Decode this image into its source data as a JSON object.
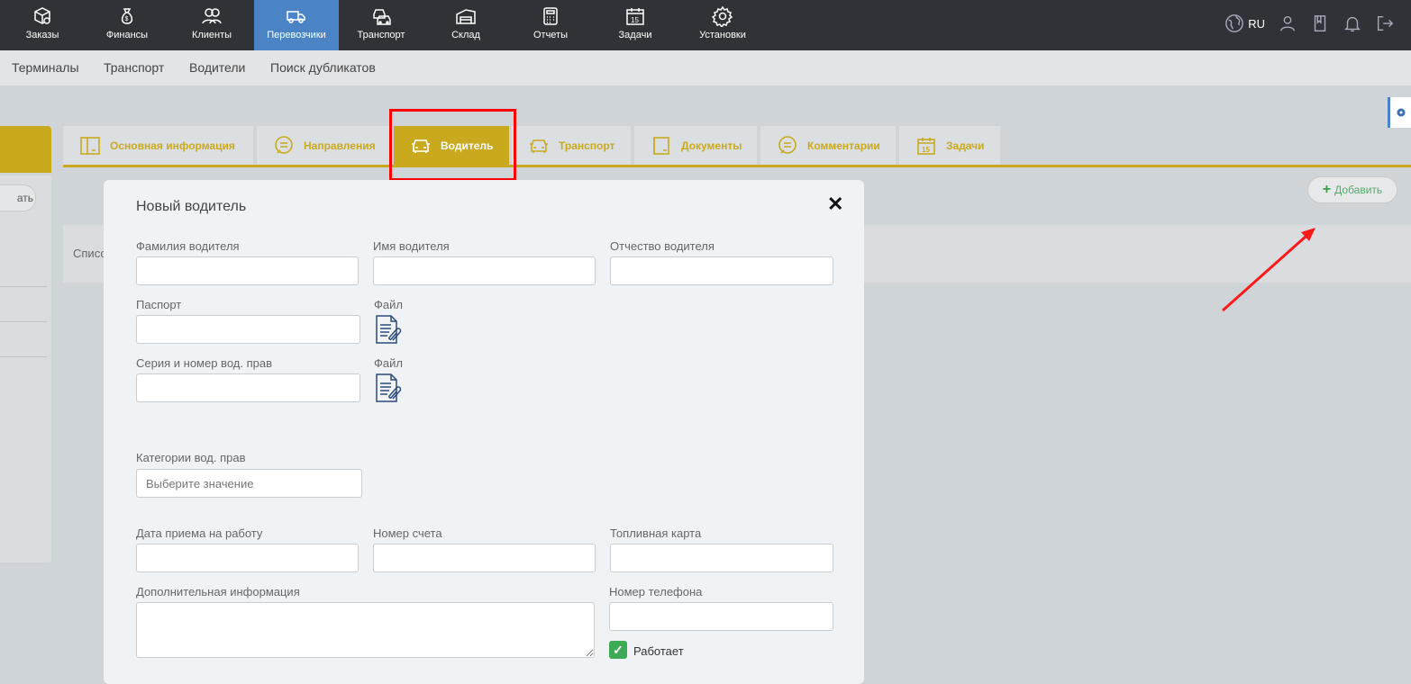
{
  "nav": {
    "items": [
      {
        "label": "Заказы",
        "icon": "box-icon"
      },
      {
        "label": "Финансы",
        "icon": "money-bag-icon"
      },
      {
        "label": "Клиенты",
        "icon": "users-icon"
      },
      {
        "label": "Перевозчики",
        "icon": "truck-icon"
      },
      {
        "label": "Транспорт",
        "icon": "cars-icon"
      },
      {
        "label": "Склад",
        "icon": "warehouse-icon"
      },
      {
        "label": "Отчеты",
        "icon": "calculator-icon"
      },
      {
        "label": "Задачи",
        "icon": "calendar-icon"
      },
      {
        "label": "Установки",
        "icon": "gear-icon"
      }
    ],
    "active": "Перевозчики",
    "language": "RU"
  },
  "subnav": {
    "items": [
      "Терминалы",
      "Транспорт",
      "Водители",
      "Поиск дубликатов"
    ]
  },
  "left": {
    "button_label": "ать"
  },
  "tabs": [
    {
      "label": "Основная информация",
      "icon": "layout-icon"
    },
    {
      "label": "Направления",
      "icon": "chat-icon"
    },
    {
      "label": "Водитель",
      "icon": "car-front-icon"
    },
    {
      "label": "Транспорт",
      "icon": "car-front-icon"
    },
    {
      "label": "Документы",
      "icon": "document-icon"
    },
    {
      "label": "Комментарии",
      "icon": "chat-icon"
    },
    {
      "label": "Задачи",
      "icon": "calendar-icon"
    }
  ],
  "active_tab": "Водитель",
  "list_label": "Списо",
  "add_button_label": "Добавить",
  "modal": {
    "title": "Новый водитель",
    "fields": {
      "last_name": "Фамилия водителя",
      "first_name": "Имя водителя",
      "patronymic": "Отчество водителя",
      "passport": "Паспорт",
      "file1": "Файл",
      "license": "Серия и номер вод. прав",
      "file2": "Файл",
      "categories": "Категории вод. прав",
      "categories_placeholder": "Выберите значение",
      "hire_date": "Дата приема на работу",
      "account": "Номер счета",
      "fuel_card": "Топливная карта",
      "extra_info": "Дополнительная информация",
      "phone": "Номер телефона",
      "working": "Работает"
    },
    "working_checked": true
  },
  "colors": {
    "accent": "#c9aa1f",
    "nav_bg": "#2f3338",
    "nav_active": "#4a84c4",
    "highlight": "#ff0000",
    "check": "#3daa55"
  }
}
